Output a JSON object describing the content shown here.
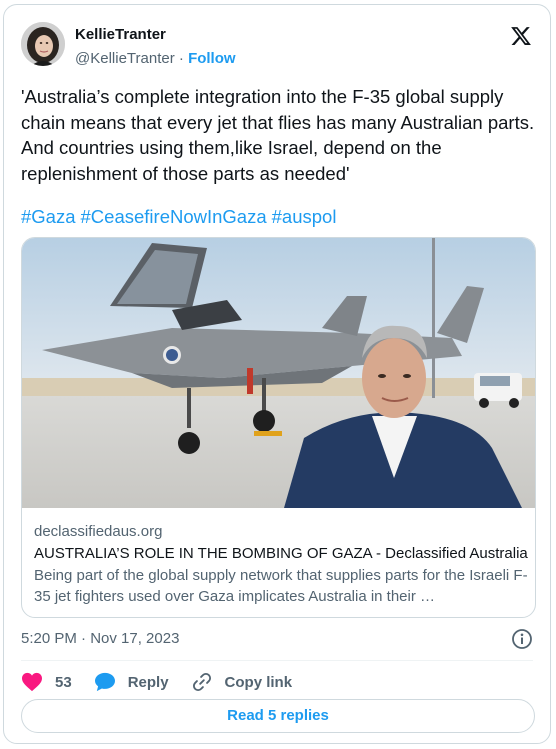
{
  "tweet": {
    "author_name": "KellieTranter",
    "author_handle": "@KellieTranter",
    "separator": " · ",
    "follow_label": "Follow",
    "text_paragraph": "'Australia’s complete integration into the F-35 global supply chain means that every jet that flies has many Australian parts. And countries using them,like Israel, depend on the replenishment of those parts as needed'",
    "hashtags": [
      "#Gaza",
      "#CeasefireNowInGaza",
      "#auspol"
    ],
    "timestamp": "5:20 PM · Nov 17, 2023"
  },
  "link_card": {
    "domain": "declassifiedaus.org",
    "title": "AUSTRALIA’S ROLE IN THE BOMBING OF GAZA - Declassified Australia",
    "description": "Being part of the global supply network that supplies parts for the Israeli F-35 jet fighters used over Gaza implicates Australia in their …",
    "image_icon": "f35-jet-photo"
  },
  "actions": {
    "like_count": "53",
    "reply_label": "Reply",
    "copy_link_label": "Copy link",
    "read_replies_label": "Read 5 replies"
  },
  "icons": {
    "brand": "x-logo-icon",
    "like": "heart-icon",
    "reply": "speech-bubble-icon",
    "copy": "link-icon",
    "info": "info-icon"
  },
  "colors": {
    "accent": "#1d9bf0",
    "like": "#f91880",
    "muted": "#536471",
    "border": "#cfd9de"
  }
}
